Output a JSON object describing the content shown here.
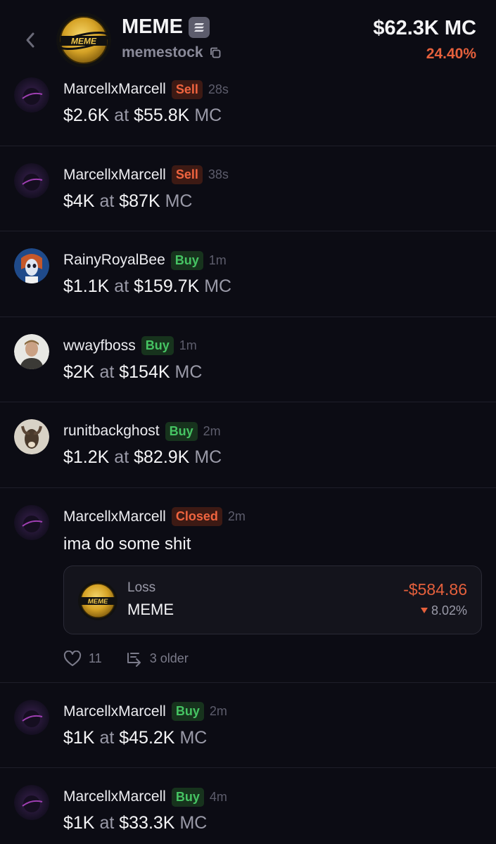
{
  "header": {
    "token_name": "MEME",
    "ticker": "memestock",
    "logo_text": "MEME",
    "market_cap": "$62.3K MC",
    "change": "24.40%",
    "accent_up": "#e5603c"
  },
  "feed": [
    {
      "user": "MarcellxMarcell",
      "badge": "Sell",
      "badge_type": "sell",
      "time": "28s",
      "amount": "$2.6K",
      "at": "at",
      "mc": "$55.8K",
      "mc_suffix": "MC"
    },
    {
      "user": "MarcellxMarcell",
      "badge": "Sell",
      "badge_type": "sell",
      "time": "38s",
      "amount": "$4K",
      "at": "at",
      "mc": "$87K",
      "mc_suffix": "MC"
    },
    {
      "user": "RainyRoyalBee",
      "badge": "Buy",
      "badge_type": "buy",
      "time": "1m",
      "amount": "$1.1K",
      "at": "at",
      "mc": "$159.7K",
      "mc_suffix": "MC"
    },
    {
      "user": "wwayfboss",
      "badge": "Buy",
      "badge_type": "buy",
      "time": "1m",
      "amount": "$2K",
      "at": "at",
      "mc": "$154K",
      "mc_suffix": "MC"
    },
    {
      "user": "runitbackghost",
      "badge": "Buy",
      "badge_type": "buy",
      "time": "2m",
      "amount": "$1.2K",
      "at": "at",
      "mc": "$82.9K",
      "mc_suffix": "MC"
    },
    {
      "user": "MarcellxMarcell",
      "badge": "Closed",
      "badge_type": "sell",
      "time": "2m",
      "comment": "ima do some shit",
      "pnl": {
        "label": "Loss",
        "token": "MEME",
        "logo_text": "MEME",
        "amount": "-$584.86",
        "pct": "8.02%"
      },
      "likes": "11",
      "older": "3 older"
    },
    {
      "user": "MarcellxMarcell",
      "badge": "Buy",
      "badge_type": "buy",
      "time": "2m",
      "amount": "$1K",
      "at": "at",
      "mc": "$45.2K",
      "mc_suffix": "MC"
    },
    {
      "user": "MarcellxMarcell",
      "badge": "Buy",
      "badge_type": "buy",
      "time": "4m",
      "amount": "$1K",
      "at": "at",
      "mc": "$33.3K",
      "mc_suffix": "MC"
    }
  ],
  "icons": {
    "back": "chevron-left-icon",
    "chain": "solana-icon",
    "copy": "copy-icon",
    "like": "heart-icon",
    "thread": "thread-icon",
    "down": "triangle-down-icon"
  }
}
